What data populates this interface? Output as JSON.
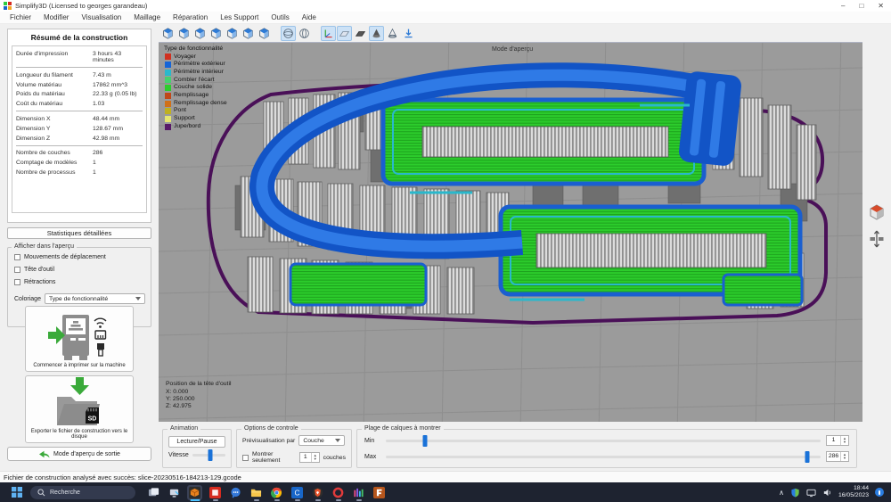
{
  "window": {
    "title": "Simplify3D (Licensed to georges garandeau)",
    "controls": [
      "minimize",
      "maximize",
      "close"
    ]
  },
  "menu": {
    "items": [
      "Fichier",
      "Modifier",
      "Visualisation",
      "Maillage",
      "Réparation",
      "Les Support",
      "Outils",
      "Aide"
    ]
  },
  "summary": {
    "title": "Résumé de la construction",
    "rows": [
      {
        "label": "Durée d'impression",
        "value": "3 hours 43 minutes",
        "sep": true
      },
      {
        "label": "Longueur du filament",
        "value": "7.43 m"
      },
      {
        "label": "Volume matériau",
        "value": "17862 mm^3"
      },
      {
        "label": "Poids du matériau",
        "value": "22.33 g (0.05 lb)"
      },
      {
        "label": "Coût du matériau",
        "value": "1.03",
        "sep": true
      },
      {
        "label": "Dimension X",
        "value": "48.44 mm"
      },
      {
        "label": "Dimension Y",
        "value": "128.67 mm"
      },
      {
        "label": "Dimension Z",
        "value": "42.98 mm",
        "sep": true
      },
      {
        "label": "Nombre de couches",
        "value": "286"
      },
      {
        "label": "Comptage de modèles",
        "value": "1"
      },
      {
        "label": "Nombre de processus",
        "value": "1"
      }
    ],
    "stats_button": "Statistiques détaillées"
  },
  "preview": {
    "title": "Afficher dans l'aperçu",
    "checkboxes": [
      {
        "label": "Mouvements de déplacement",
        "checked": false
      },
      {
        "label": "Tête d'outil",
        "checked": false
      },
      {
        "label": "Rétractions",
        "checked": false
      }
    ],
    "coloring_label": "Coloriage",
    "coloring_value": "Type de fonctionnalité"
  },
  "actions": {
    "print_label": "Commencer à imprimer sur la machine",
    "export_label": "Exporter le fichier de construction vers le disque",
    "exit_label": "Mode d'aperçu de sortie"
  },
  "toolbar": {
    "icons": [
      {
        "name": "view-iso",
        "glyph": "cube"
      },
      {
        "name": "view-front",
        "glyph": "cube"
      },
      {
        "name": "view-top",
        "glyph": "cube"
      },
      {
        "name": "view-right",
        "glyph": "cube"
      },
      {
        "name": "view-left",
        "glyph": "cube"
      },
      {
        "name": "view-back",
        "glyph": "cube"
      },
      {
        "name": "view-bottom",
        "glyph": "cube"
      },
      {
        "name": "perspective",
        "glyph": "sphere",
        "pressed": true,
        "gap": true
      },
      {
        "name": "orthographic",
        "glyph": "sphere2"
      },
      {
        "name": "coordinate-axes",
        "glyph": "axis",
        "pressed": true,
        "gap": true
      },
      {
        "name": "show-platform",
        "glyph": "platform",
        "pressed": true
      },
      {
        "name": "solid-platform",
        "glyph": "platformSolid"
      },
      {
        "name": "cross-section",
        "glyph": "coneSolid",
        "pressed": true
      },
      {
        "name": "model-outline",
        "glyph": "coneOutline"
      },
      {
        "name": "drop-to-platform",
        "glyph": "arrowDown"
      }
    ]
  },
  "viewport": {
    "mode_label": "Mode d'aperçu",
    "legend": {
      "title": "Type de fonctionnalité",
      "items": [
        {
          "label": "Voyager",
          "color": "#d03020"
        },
        {
          "label": "Périmètre extérieur",
          "color": "#1565d8"
        },
        {
          "label": "Périmètre intérieur",
          "color": "#29b8cc"
        },
        {
          "label": "Combler l'écart",
          "color": "#45d06e"
        },
        {
          "label": "Couche solide",
          "color": "#2ccc2c"
        },
        {
          "label": "Remplissage",
          "color": "#c04818"
        },
        {
          "label": "Remplissage dense",
          "color": "#d07018"
        },
        {
          "label": "Pont",
          "color": "#c0b020"
        },
        {
          "label": "Support",
          "color": "#e6e670"
        },
        {
          "label": "Jupe/bord",
          "color": "#581a68"
        }
      ]
    },
    "toolhead": {
      "title": "Position de la tête d'outil",
      "x": "X: 0.000",
      "y": "Y: 250.000",
      "z": "Z: 42.975"
    }
  },
  "colors": {
    "perimeter_blue": "#1254c6",
    "perimeter_light": "#2f7ae6",
    "solid_green": "#2ccc2c",
    "skirt_purple": "#4a1058",
    "inner_cyan": "#29b8cc",
    "accent_blue": "#1a72d8"
  },
  "bottom": {
    "animation": {
      "title": "Animation",
      "play_button": "Lecture/Pause",
      "speed_label": "Vitesse",
      "speed_pct": 55
    },
    "control": {
      "title": "Options de controle",
      "preview_by_label": "Prévisualisation par",
      "preview_by_value": "Couche",
      "show_only_label": "Montrer seulement",
      "show_only_checked": false,
      "layer_count": "1",
      "layers_suffix": "couches"
    },
    "range": {
      "title": "Plage de calques à montrer",
      "min_label": "Min",
      "min_value": "1",
      "min_pct": 9,
      "max_label": "Max",
      "max_value": "286",
      "max_pct": 97
    }
  },
  "status": {
    "text": "Fichier de construction analysé avec succès: slice-20230516-184213-129.gcode"
  },
  "taskbar": {
    "search_placeholder": "Recherche",
    "apps": [
      {
        "name": "task-view",
        "running": false
      },
      {
        "name": "remote-device",
        "running": false
      },
      {
        "name": "simplify3d",
        "active": true
      },
      {
        "name": "red-app",
        "running": true
      },
      {
        "name": "chat-app",
        "running": false
      },
      {
        "name": "file-explorer",
        "running": true
      },
      {
        "name": "chrome",
        "running": true
      },
      {
        "name": "c-app",
        "running": true
      },
      {
        "name": "brave",
        "running": true
      },
      {
        "name": "opera",
        "running": true
      },
      {
        "name": "media-app",
        "running": true
      },
      {
        "name": "freecad",
        "running": false
      }
    ],
    "tray": {
      "time": "18:44",
      "date": "16/05/2023"
    }
  }
}
